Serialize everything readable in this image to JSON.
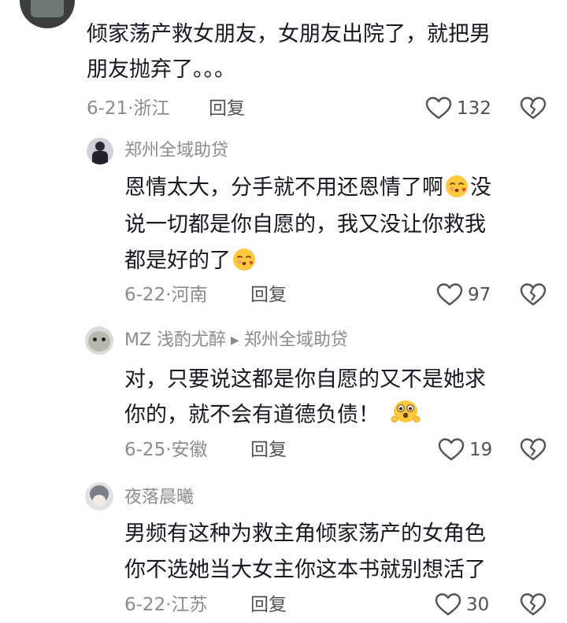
{
  "comments": [
    {
      "lines": [
        "倾家荡产救女朋友，女朋友出院了，就把男",
        "朋友抛弃了。。。"
      ],
      "date": "6-21",
      "location": "浙江",
      "reply_label": "回复",
      "likes": "132"
    },
    {
      "author": "郑州全域助贷",
      "line1": "恩情太大，分手就不用还恩情了啊",
      "line1_tail": "没",
      "line2": "说一切都是你自愿的，我又没让你救我",
      "line3": "都是好的了",
      "date": "6-22",
      "location": "河南",
      "reply_label": "回复",
      "likes": "97"
    },
    {
      "author": "MZ 浅酌尤醉",
      "reply_to": "郑州全域助贷",
      "line1": "对，只要说这都是你自愿的又不是她求",
      "line2": "你的，就不会有道德负债！",
      "date": "6-25",
      "location": "安徽",
      "reply_label": "回复",
      "likes": "19"
    },
    {
      "author": "夜落晨曦",
      "lines": [
        "男频有这种为救主角倾家荡产的女角色",
        "你不选她当大女主你这本书就别想活了"
      ],
      "date": "6-22",
      "location": "江苏",
      "reply_label": "回复",
      "likes": "30"
    }
  ],
  "icons": {
    "like": "heart-outline-icon",
    "dislike": "broken-heart-icon",
    "emoji_kiss": "blowing-kiss-emoji",
    "emoji_surprised": "surprised-emoji",
    "reply_arrow": "triangle-right-icon"
  },
  "colors": {
    "text": "#161823",
    "meta": "#8a8b91",
    "emoji": "#ffc83d"
  }
}
